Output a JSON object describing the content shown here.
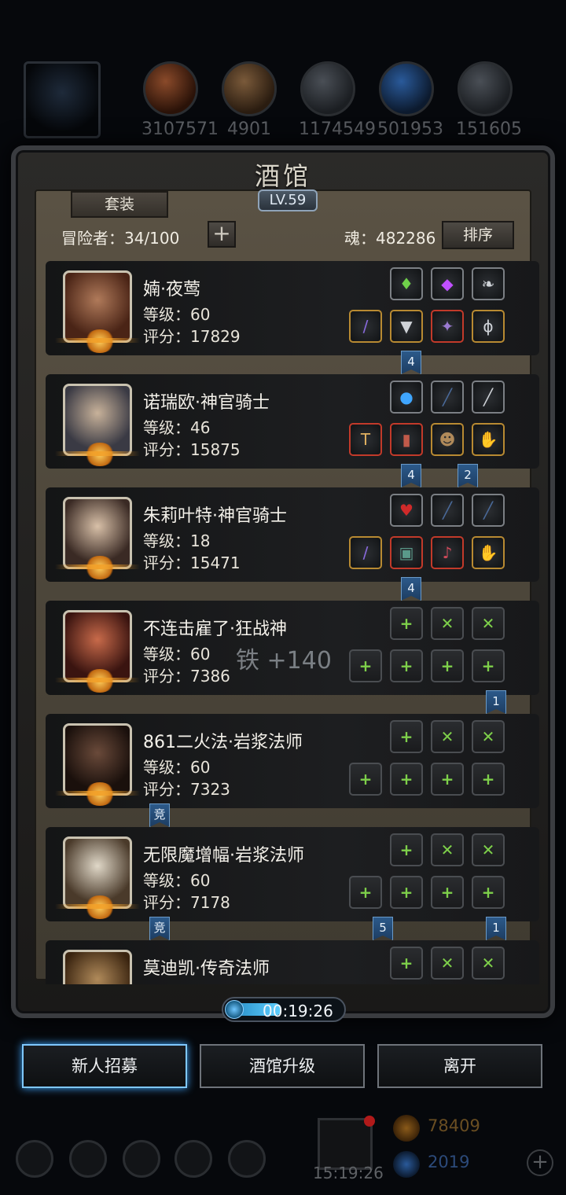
{
  "resources": [
    {
      "icon": "meat-icon",
      "value": "3107571"
    },
    {
      "icon": "wood-icon",
      "value": "4901"
    },
    {
      "icon": "stone-icon",
      "value": "1174549"
    },
    {
      "icon": "crystal-icon",
      "value": "501953"
    },
    {
      "icon": "iron-icon",
      "value": "151605"
    }
  ],
  "modal": {
    "title": "酒馆",
    "level": "LV.59",
    "suit_label": "套装",
    "adventurers": "冒险者：34/100",
    "plus": "+",
    "soul": "魂：482286",
    "sort_label": "排序"
  },
  "heroes": [
    {
      "name": "婻·夜莺",
      "level": "等级：60",
      "score": "评分：17829"
    },
    {
      "name": "诺瑞欧·神官骑士",
      "level": "等级：46",
      "score": "评分：15875"
    },
    {
      "name": "朱莉叶特·神官骑士",
      "level": "等级：18",
      "score": "评分：15471"
    },
    {
      "name": "不连击雇了·狂战神",
      "level": "等级：60",
      "score": "评分：7386"
    },
    {
      "name": "861二火法·岩浆法师",
      "level": "等级：60",
      "score": "评分：7323"
    },
    {
      "name": "无限魔增幅·岩浆法师",
      "level": "等级：60",
      "score": "评分：7178"
    },
    {
      "name": "莫迪凯·传奇法师",
      "level": "",
      "score": ""
    }
  ],
  "tags": {
    "t1": "4",
    "t2": "4",
    "t3": "2",
    "t4": "4",
    "t5": "1",
    "t6": "竞",
    "t7": "竞",
    "t8": "5",
    "t9": "1"
  },
  "float_text": "铁 +140",
  "timer": "00:19:26",
  "buttons": {
    "recruit": "新人招募",
    "upgrade": "酒馆升级",
    "leave": "离开"
  },
  "bottom": {
    "clock": "15:19:26",
    "gold": "78409",
    "gems": "2019",
    "plus": "+"
  },
  "colors": {
    "accent_blue": "#3fa6ff",
    "gold": "#c9a14a",
    "tag_blue": "#2c5a8a"
  }
}
